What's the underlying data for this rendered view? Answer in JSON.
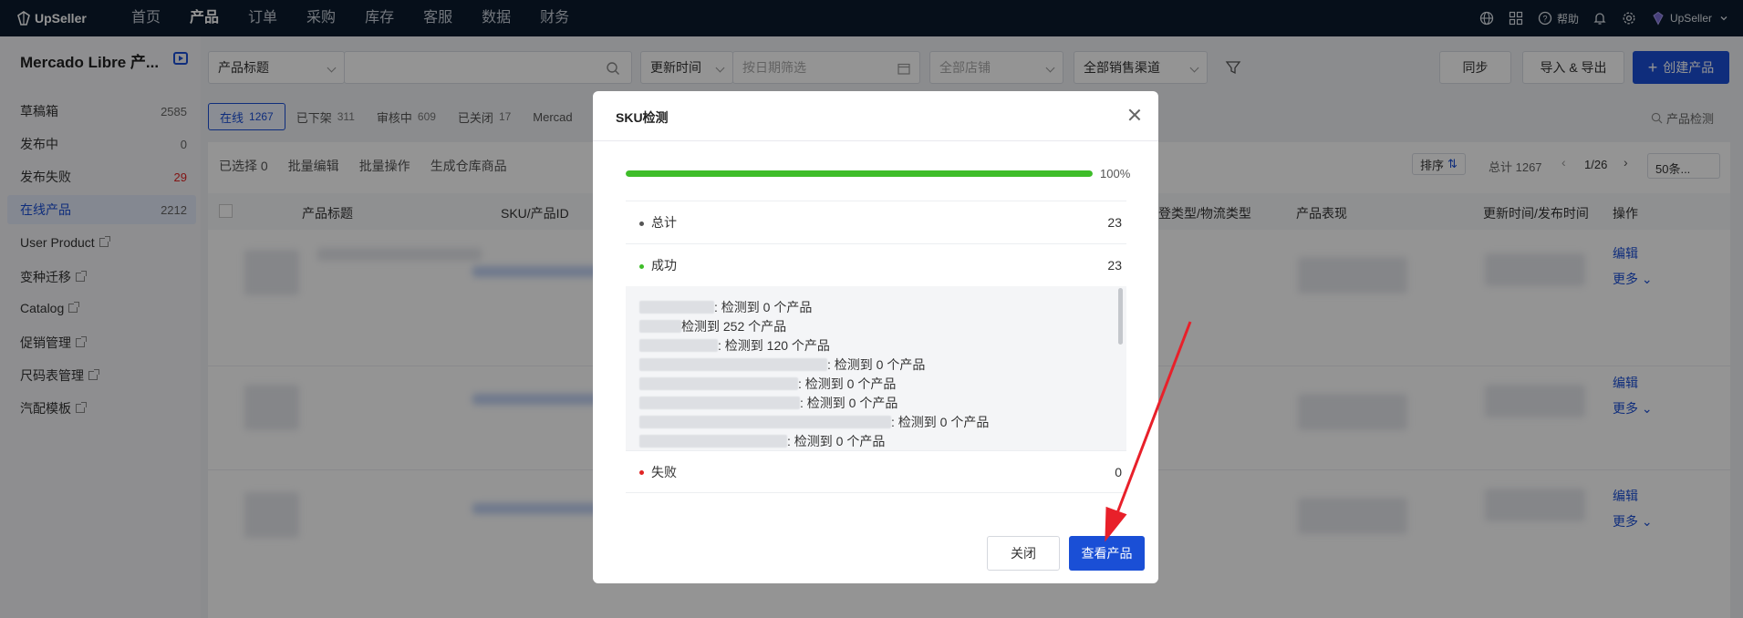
{
  "brand": "UpSeller",
  "nav": {
    "items": [
      "首页",
      "产品",
      "订单",
      "采购",
      "库存",
      "客服",
      "数据",
      "财务"
    ],
    "active_index": 1,
    "right": {
      "help": "帮助",
      "user": "UpSeller"
    }
  },
  "sidebar": {
    "title": "Mercado Libre 产...",
    "items": [
      {
        "label": "草稿箱",
        "count": "2585"
      },
      {
        "label": "发布中",
        "count": "0"
      },
      {
        "label": "发布失败",
        "count": "29"
      },
      {
        "label": "在线产品",
        "count": "2212"
      }
    ],
    "links": [
      "User Product",
      "变种迁移",
      "Catalog",
      "促销管理",
      "尺码表管理",
      "汽配模板"
    ]
  },
  "filters": {
    "search_type": "产品标题",
    "time_type": "更新时间",
    "date_placeholder": "按日期筛选",
    "store": "全部店铺",
    "channel": "全部销售渠道",
    "sync": "同步",
    "import_export": "导入 & 导出",
    "create": "创建产品"
  },
  "tabs": [
    {
      "label": "在线",
      "count": "1267"
    },
    {
      "label": "已下架",
      "count": "311"
    },
    {
      "label": "审核中",
      "count": "609"
    },
    {
      "label": "已关闭",
      "count": "17"
    },
    {
      "label": "Mercad",
      "count": ""
    }
  ],
  "product_check": "产品检测",
  "toolbar": {
    "selected": "已选择 0",
    "batch_edit": "批量编辑",
    "batch_ops": "批量操作",
    "gen_warehouse": "生成仓库商品",
    "sort": "排序",
    "total": "总计 1267",
    "page": "1/26",
    "page_size": "50条..."
  },
  "columns": {
    "title": "产品标题",
    "sku": "SKU/产品ID",
    "shipping": "登类型/物流类型",
    "performance": "产品表现",
    "time": "更新时间/发布时间",
    "ops": "操作"
  },
  "row_actions": {
    "edit": "编辑",
    "more": "更多"
  },
  "modal": {
    "title": "SKU检测",
    "progress": 100,
    "progress_label": "100%",
    "total_label": "总计",
    "total_value": "23",
    "success_label": "成功",
    "success_value": "23",
    "fail_label": "失败",
    "fail_value": "0",
    "details": [
      ": 检测到 0 个产品",
      "检测到 252 个产品",
      ": 检测到 120 个产品",
      ": 检测到 0 个产品",
      ": 检测到 0 个产品",
      ": 检测到 0 个产品",
      ": 检测到 0 个产品",
      ": 检测到 0 个产品"
    ],
    "close": "关闭",
    "view": "查看产品"
  },
  "colors": {
    "accent": "#1a4fd6",
    "success": "#3ebd29",
    "fail": "#e02424",
    "nav_bg": "#0b1b2e"
  }
}
